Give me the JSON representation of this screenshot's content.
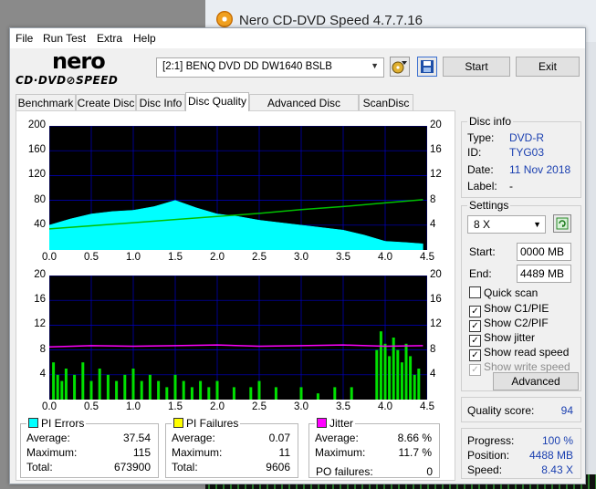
{
  "bg_window": {
    "title": "Nero CD-DVD Speed 4.7.7.16"
  },
  "menu": [
    "File",
    "Run Test",
    "Extra",
    "Help"
  ],
  "logo": {
    "brand": "nero",
    "product": "CD·DVD⊘SPEED"
  },
  "toolbar": {
    "drive_label": "[2:1]   BENQ DVD DD DW1640 BSLB",
    "start_label": "Start",
    "exit_label": "Exit"
  },
  "tabs": [
    "Benchmark",
    "Create Disc",
    "Disc Info",
    "Disc Quality",
    "Advanced Disc Quality",
    "ScanDisc"
  ],
  "active_tab": "Disc Quality",
  "disc_info": {
    "title": "Disc info",
    "type_label": "Type:",
    "type": "DVD-R",
    "id_label": "ID:",
    "id": "TYG03",
    "date_label": "Date:",
    "date": "11 Nov 2018",
    "label_label": "Label:",
    "label": "-"
  },
  "settings": {
    "title": "Settings",
    "speed": "8 X",
    "start_label": "Start:",
    "start": "0000 MB",
    "end_label": "End:",
    "end": "4489 MB",
    "quick_scan": "Quick scan",
    "show_c1pie": "Show C1/PIE",
    "show_c2pif": "Show C2/PIF",
    "show_jitter": "Show jitter",
    "show_read_speed": "Show read speed",
    "show_write_speed": "Show write speed",
    "advanced_label": "Advanced"
  },
  "quality": {
    "label": "Quality score:",
    "score": "94"
  },
  "progress": {
    "progress_label": "Progress:",
    "progress": "100 %",
    "position_label": "Position:",
    "position": "4488 MB",
    "speed_label": "Speed:",
    "speed": "8.43 X"
  },
  "pi_errors": {
    "title": "PI Errors",
    "avg_label": "Average:",
    "avg": "37.54",
    "max_label": "Maximum:",
    "max": "115",
    "total_label": "Total:",
    "total": "673900"
  },
  "pi_failures": {
    "title": "PI Failures",
    "avg_label": "Average:",
    "avg": "0.07",
    "max_label": "Maximum:",
    "max": "11",
    "total_label": "Total:",
    "total": "9606"
  },
  "jitter": {
    "title": "Jitter",
    "avg_label": "Average:",
    "avg": "8.66 %",
    "max_label": "Maximum:",
    "max": "11.7 %",
    "po_label": "PO failures:",
    "po": "0"
  },
  "colors": {
    "pie": "#00ffff",
    "pif": "#ffff00",
    "jitter": "#ff00ff",
    "speed": "#00c000",
    "bars": "#00e000",
    "plot_bg": "#000000",
    "grid": "#0000c8"
  },
  "chart_data": [
    {
      "type": "area",
      "x_ticks": [
        "0.0",
        "0.5",
        "1.0",
        "1.5",
        "2.0",
        "2.5",
        "3.0",
        "3.5",
        "4.0",
        "4.5"
      ],
      "y_ticks_left": [
        "200",
        "160",
        "120",
        "80",
        "40"
      ],
      "y_ticks_right": [
        "20",
        "16",
        "12",
        "8",
        "4"
      ],
      "xlim": [
        0,
        4.5
      ],
      "ylim_left": [
        0,
        200
      ],
      "ylim_right": [
        0,
        20
      ],
      "series": [
        {
          "name": "PI Errors",
          "x": [
            0.0,
            0.25,
            0.5,
            0.75,
            1.0,
            1.25,
            1.5,
            1.75,
            2.0,
            2.25,
            2.5,
            2.75,
            3.0,
            3.25,
            3.5,
            3.75,
            4.0,
            4.25,
            4.45
          ],
          "y": [
            40,
            50,
            58,
            62,
            64,
            70,
            80,
            68,
            58,
            54,
            48,
            44,
            40,
            36,
            32,
            24,
            14,
            12,
            10
          ]
        },
        {
          "name": "Read speed",
          "x": [
            0.0,
            0.5,
            1.0,
            1.5,
            2.0,
            2.5,
            3.0,
            3.5,
            4.0,
            4.45
          ],
          "y": [
            3.4,
            3.9,
            4.4,
            4.9,
            5.4,
            5.9,
            6.5,
            7.0,
            7.6,
            8.1
          ]
        }
      ],
      "grid": true
    },
    {
      "type": "bar",
      "x_ticks": [
        "0.0",
        "0.5",
        "1.0",
        "1.5",
        "2.0",
        "2.5",
        "3.0",
        "3.5",
        "4.0",
        "4.5"
      ],
      "y_ticks_left": [
        "20",
        "16",
        "12",
        "8",
        "4"
      ],
      "y_ticks_right": [
        "20",
        "16",
        "12",
        "8",
        "4"
      ],
      "xlim": [
        0,
        4.5
      ],
      "ylim": [
        0,
        20
      ],
      "series": [
        {
          "name": "PI Failures",
          "x": [
            0.05,
            0.1,
            0.15,
            0.2,
            0.3,
            0.4,
            0.5,
            0.6,
            0.7,
            0.8,
            0.9,
            1.0,
            1.1,
            1.2,
            1.3,
            1.4,
            1.5,
            1.6,
            1.7,
            1.8,
            1.9,
            2.0,
            2.2,
            2.4,
            2.5,
            2.7,
            3.0,
            3.2,
            3.4,
            3.6,
            3.9,
            3.95,
            4.0,
            4.05,
            4.1,
            4.15,
            4.2,
            4.25,
            4.3,
            4.35,
            4.4
          ],
          "y": [
            6,
            4,
            3,
            5,
            4,
            6,
            3,
            5,
            4,
            3,
            4,
            5,
            3,
            4,
            3,
            2,
            4,
            3,
            2,
            3,
            2,
            3,
            2,
            2,
            3,
            2,
            2,
            1,
            2,
            2,
            8,
            11,
            9,
            7,
            10,
            8,
            6,
            9,
            7,
            4,
            5
          ]
        },
        {
          "name": "Jitter",
          "x": [
            0.0,
            0.5,
            1.0,
            1.5,
            2.0,
            2.5,
            3.0,
            3.5,
            4.0,
            4.45
          ],
          "y": [
            8.5,
            8.7,
            8.6,
            8.7,
            8.8,
            8.6,
            8.7,
            8.8,
            8.6,
            8.7
          ]
        }
      ],
      "grid": true
    }
  ]
}
